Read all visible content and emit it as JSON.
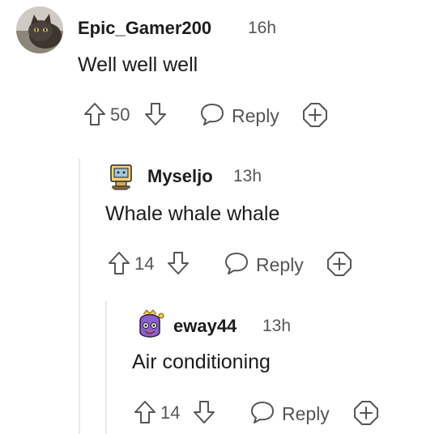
{
  "comments": [
    {
      "username": "Epic_Gamer200",
      "time": "16h",
      "text": "Well well well",
      "score": "50",
      "reply_label": "Reply",
      "avatar": "cat-photo-avatar"
    },
    {
      "username": "Myseljo",
      "time": "13h",
      "text": "Whale whale whale",
      "score": "14",
      "reply_label": "Reply",
      "avatar": "computer-character-avatar"
    },
    {
      "username": "eway44",
      "time": "13h",
      "text": "Air conditioning",
      "score": "14",
      "reply_label": "Reply",
      "avatar": "purple-character-avatar"
    }
  ],
  "icons": {
    "upvote": "arrow-up-icon",
    "downvote": "arrow-down-icon",
    "reply": "speech-bubble-icon",
    "award": "plus-octagon-icon"
  },
  "colors": {
    "text": "#1c1c1c",
    "meta": "#555555",
    "thread_line": "#e9e9e9"
  }
}
